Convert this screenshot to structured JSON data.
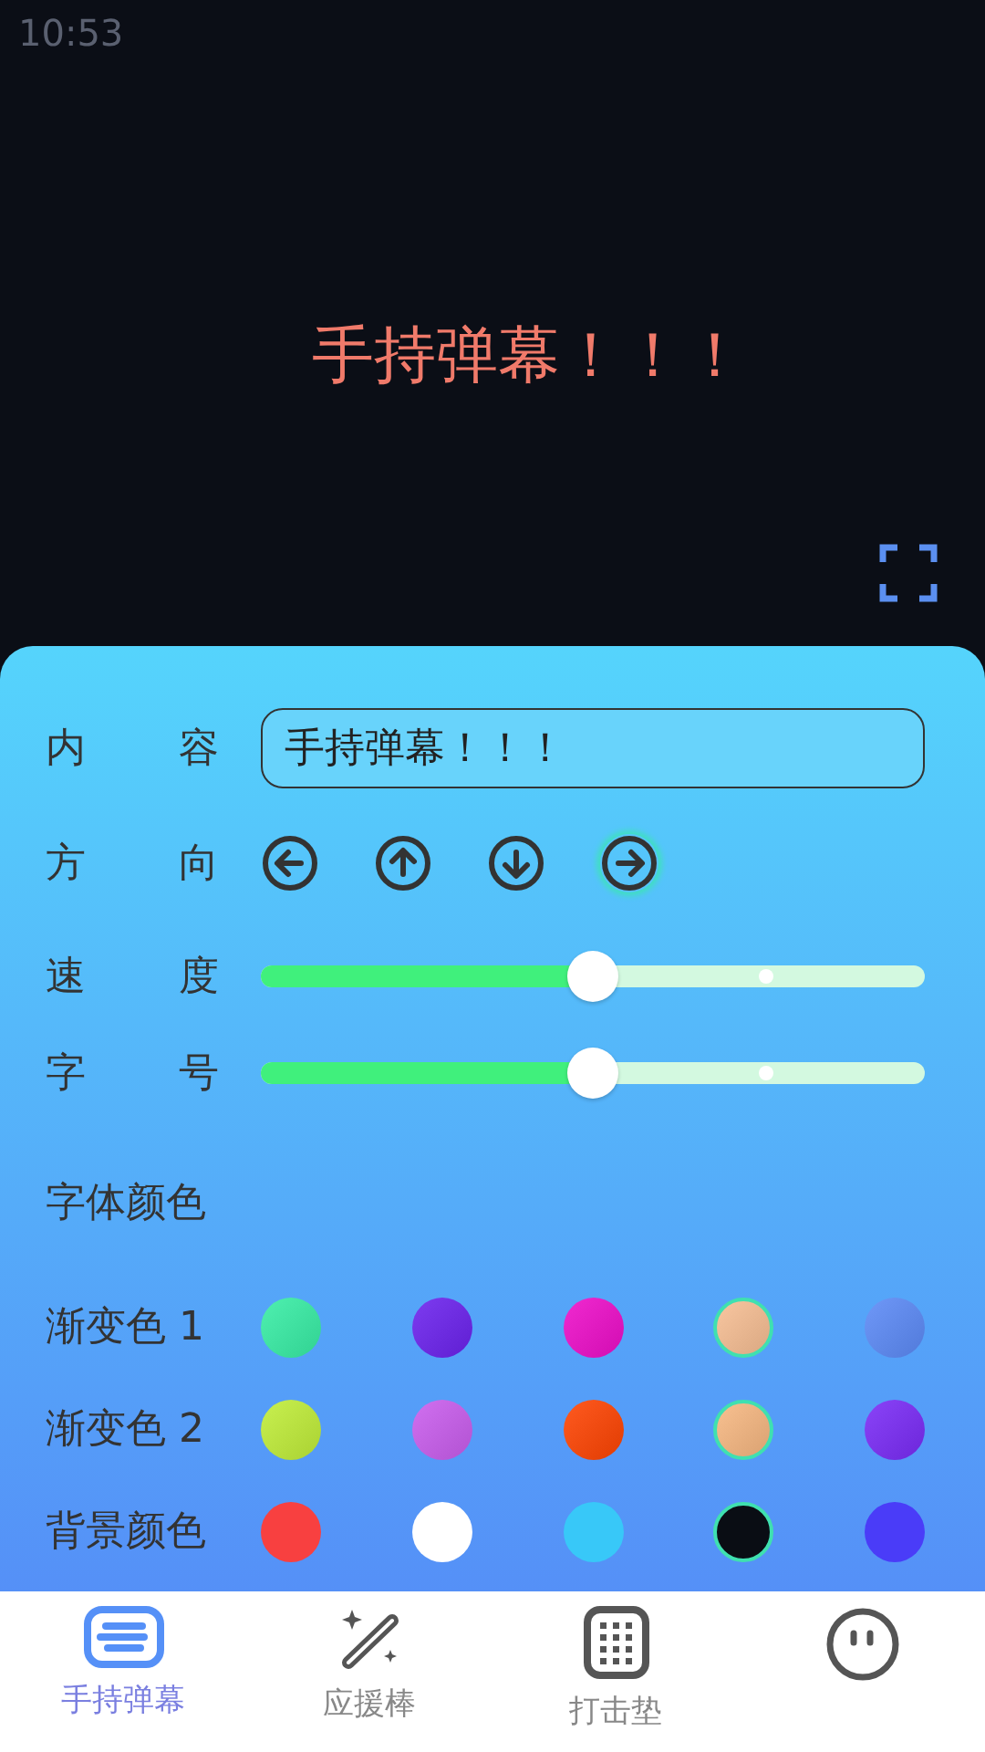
{
  "status_bar": {
    "time": "10:53"
  },
  "preview": {
    "text": "手持弹幕！！！",
    "color": "#f07a6a"
  },
  "panel": {
    "content": {
      "label": "内 容",
      "value": "手持弹幕！！！"
    },
    "direction": {
      "label": "方 向",
      "options": [
        {
          "kind": "left",
          "selected": false
        },
        {
          "kind": "up",
          "selected": false
        },
        {
          "kind": "down",
          "selected": false
        },
        {
          "kind": "right",
          "selected": true
        }
      ]
    },
    "sliders": [
      {
        "label": "速 度",
        "level": 0.5
      },
      {
        "label": "字 号",
        "level": 0.5
      }
    ],
    "font_color_title": "字体颜色",
    "swatch_rows": [
      {
        "label": "渐变色 1",
        "swatches": [
          {
            "color": "#4ff0b0",
            "selected": false
          },
          {
            "color": "#7d3cf0",
            "selected": false
          },
          {
            "color": "#f02ad0",
            "selected": false
          },
          {
            "color": "#f8c6a0",
            "selected": true
          },
          {
            "color": "#6f98f8",
            "selected": false
          }
        ]
      },
      {
        "label": "渐变色 2",
        "swatches": [
          {
            "color": "#c8f050",
            "selected": false
          },
          {
            "color": "#d070f0",
            "selected": false
          },
          {
            "color": "#ff5a20",
            "selected": false
          },
          {
            "color": "#f8c090",
            "selected": true
          },
          {
            "color": "#8a44f8",
            "selected": false
          }
        ]
      },
      {
        "label": "背景颜色",
        "swatches": [
          {
            "color": "#f84040",
            "selected": false
          },
          {
            "color": "#ffffff",
            "selected": false
          },
          {
            "color": "#38c8f8",
            "selected": false
          },
          {
            "color": "#0a0d14",
            "selected": true
          },
          {
            "color": "#4a3cf8",
            "selected": false
          }
        ]
      }
    ]
  },
  "tabs": [
    {
      "kind": "danmaku",
      "label": "手持弹幕",
      "selected": true
    },
    {
      "kind": "wand",
      "label": "应援棒",
      "selected": false
    },
    {
      "kind": "pad",
      "label": "打击垫",
      "selected": false
    },
    {
      "kind": "face",
      "selected": false
    }
  ]
}
